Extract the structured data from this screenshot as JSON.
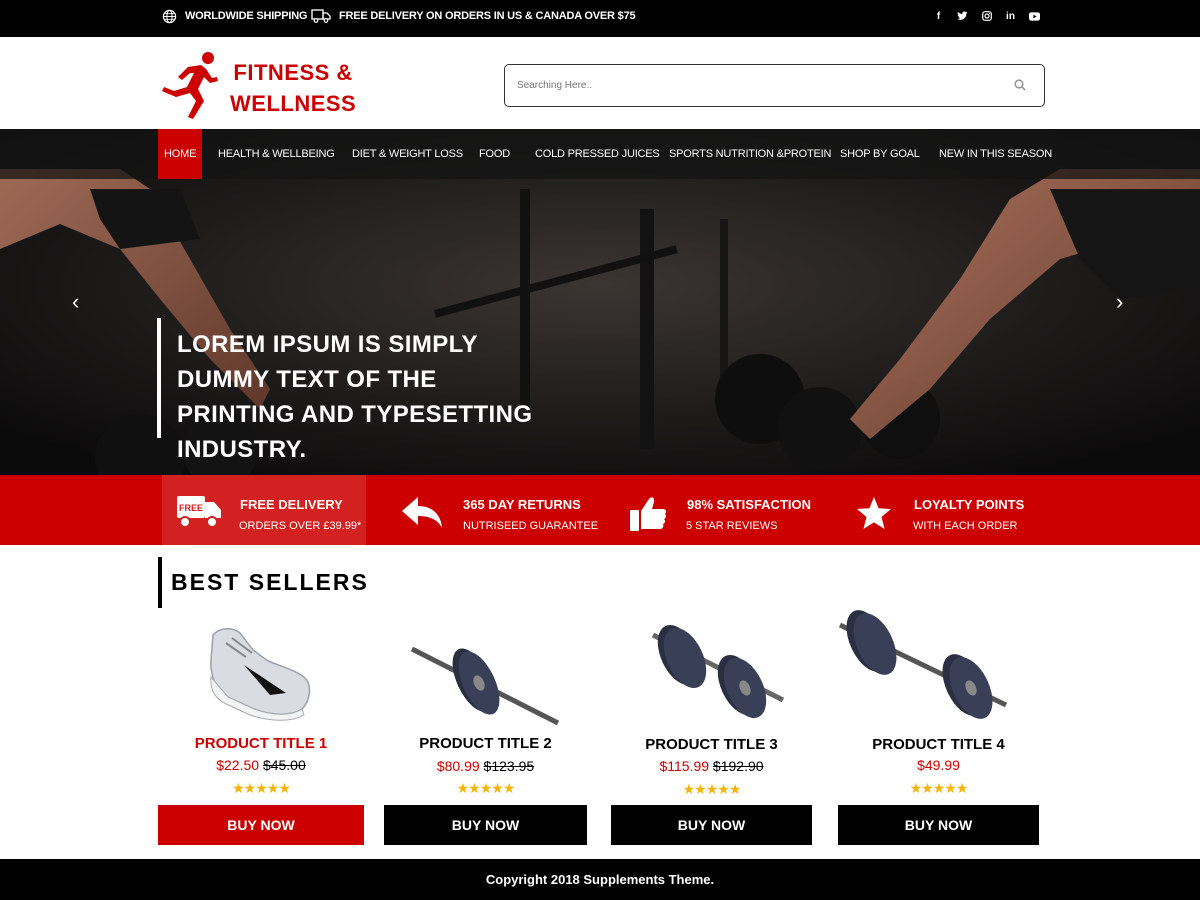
{
  "topbar": {
    "shipping_label": "WORLDWIDE SHIPPING",
    "delivery_label": "FREE DELIVERY ON ORDERS IN US & CANADA OVER $75",
    "social": [
      "facebook-icon",
      "twitter-icon",
      "instagram-icon",
      "linkedin-icon",
      "youtube-icon"
    ]
  },
  "header": {
    "logo_line1": "FITNESS &",
    "logo_line2": "WELLNESS",
    "search_placeholder": "Searching Here.."
  },
  "nav": {
    "items": [
      {
        "label": "HOME",
        "active": true
      },
      {
        "label": "HEALTH & WELLBEING"
      },
      {
        "label": "DIET & WEIGHT LOSS"
      },
      {
        "label": "FOOD"
      },
      {
        "label": "COLD PRESSED JUICES"
      },
      {
        "label": "SPORTS NUTRITION &PROTEIN"
      },
      {
        "label": "SHOP BY GOAL"
      },
      {
        "label": "NEW IN THIS SEASON"
      }
    ]
  },
  "hero": {
    "title": "LOREM IPSUM IS SIMPLY DUMMY TEXT OF THE PRINTING AND TYPESETTING INDUSTRY."
  },
  "features": [
    {
      "title": "FREE DELIVERY",
      "sub": "ORDERS OVER £39.99*",
      "icon": "delivery-truck-icon",
      "icon_text": "FREE"
    },
    {
      "title": "365 DAY RETURNS",
      "sub": "NUTRISEED GUARANTEE",
      "icon": "return-arrow-icon"
    },
    {
      "title": "98% SATISFACTION",
      "sub": "5 STAR REVIEWS",
      "icon": "thumbs-up-icon"
    },
    {
      "title": "LOYALTY POINTS",
      "sub": "WITH EACH ORDER",
      "icon": "star-icon"
    }
  ],
  "best_sellers": {
    "title": "BEST SELLERS",
    "products": [
      {
        "title": "PRODUCT TITLE 1",
        "price": "$22.50",
        "old_price": "$45.00",
        "stars": "★★★★★",
        "button": "BUY NOW",
        "image": "sneaker-image"
      },
      {
        "title": "PRODUCT TITLE 2",
        "price": "$80.99",
        "old_price": "$123.95",
        "stars": "★★★★★",
        "button": "BUY NOW",
        "image": "barbell-image"
      },
      {
        "title": "PRODUCT TITLE 3",
        "price": "$115.99",
        "old_price": "$192.90",
        "stars": "★★★★★",
        "button": "BUY NOW",
        "image": "dumbbell-image"
      },
      {
        "title": "PRODUCT TITLE 4",
        "price": "$49.99",
        "old_price": "",
        "stars": "★★★★★",
        "button": "BUY NOW",
        "image": "barbell-image"
      }
    ]
  },
  "footer": {
    "copyright": "Copyright 2018 Supplements Theme."
  },
  "colors": {
    "accent": "#cc0000",
    "dark": "#000000",
    "star": "#f4b400"
  }
}
